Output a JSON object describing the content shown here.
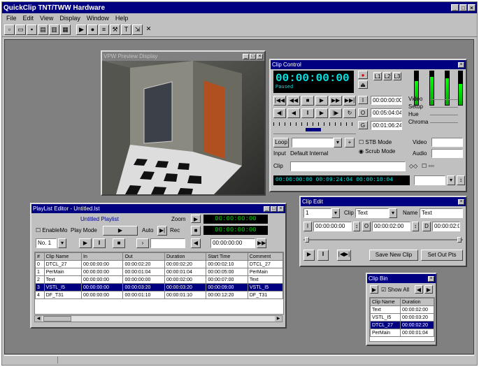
{
  "app": {
    "title": "QuickClip TNT/TWW Hardware"
  },
  "menu": [
    "File",
    "Edit",
    "View",
    "Display",
    "Window",
    "Help"
  ],
  "toolbar_icons": [
    "new-icon",
    "open-icon",
    "save-icon",
    "print-icon",
    "film-icon",
    "clip-icon",
    "play-icon",
    "record-icon",
    "list-icon",
    "tools-icon",
    "text-icon",
    "exit-icon",
    "close-icon"
  ],
  "video_window": {
    "title": "VPW Preview Display"
  },
  "clip_control": {
    "title": "Clip Control",
    "timecode": "00:00:00:00",
    "status": "Paused",
    "tc_fields": [
      "00:00:00:00",
      "00:05:04:04",
      "00:01:06:24"
    ],
    "tabs": [
      "L1",
      "L2",
      "L3"
    ],
    "sliders": [
      "Video",
      "Setup",
      "Hue",
      "Chroma"
    ],
    "loop_label": "Loop",
    "check_label": "STB Mode",
    "radio_label": "Scrub Mode",
    "options": [
      "Video",
      "Audio"
    ],
    "input_label": "Input",
    "input_value": "Default Internal",
    "clip_label": "Clip",
    "status_row": "00:00:00:00  00:09:24:04  00:00:10:04"
  },
  "playlist": {
    "title": "PlayList Editor - Untitled.lst",
    "subtitle": "Untitled Playlist",
    "enable_label": "EnableMo",
    "mode_label": "Play Mode",
    "auto_label": "Auto",
    "zoom_label": "Zoom",
    "rec_label": "Rec",
    "time1": "00:00:00:00",
    "time2": "00:00:00:00",
    "time3": "00:00:00:00",
    "headers": [
      "#",
      "Clip Name",
      "In",
      "Out",
      "Duration",
      "Start Time",
      "Comment"
    ],
    "rows": [
      [
        "0",
        "DTCL_27",
        "00:00:00:00",
        "00:00:02:20",
        "00:00:02:20",
        "00:00:02:10",
        "DTCL_27"
      ],
      [
        "1",
        "PerMain",
        "00:00:00:00",
        "00:00:01:04",
        "00:00:01:04",
        "00:00:05:00",
        "PerMain"
      ],
      [
        "2",
        "Text",
        "00:00:00:00",
        "00:00:00:00",
        "00:00:02:00",
        "00:00:07:00",
        "Text"
      ],
      [
        "3",
        "VSTL_I5",
        "00:00:00:00",
        "00:00:03:20",
        "00:00:03:20",
        "00:00:09:00",
        "VSTL_I5"
      ],
      [
        "4",
        "DF_T31",
        "00:00:00:00",
        "00:00:01:10",
        "00:00:01:10",
        "00:00:12:20",
        "DF_T31"
      ]
    ],
    "selected_row": 3
  },
  "clip_edit": {
    "title": "Clip Edit",
    "clip_label": "Clip",
    "clip_value": "Text",
    "name_label": "Name",
    "name_value": "Text",
    "in_value": "00:00:00:00",
    "out_value": "00:00:02:00",
    "dur_value": "00:00:02:00",
    "btn_save": "Save New Clip",
    "btn_set": "Set Out Pts"
  },
  "clip_bin": {
    "title": "Clip Bin",
    "filter_label": "Show All",
    "headers": [
      "Clip Name",
      "Duration"
    ],
    "rows": [
      [
        "Text",
        "00:00:02:00"
      ],
      [
        "VSTL_I5",
        "00:00:03:20"
      ],
      [
        "DTCL_27",
        "00:00:02:20"
      ],
      [
        "PerMain",
        "00:00:01:04"
      ]
    ],
    "selected_row": 2
  }
}
